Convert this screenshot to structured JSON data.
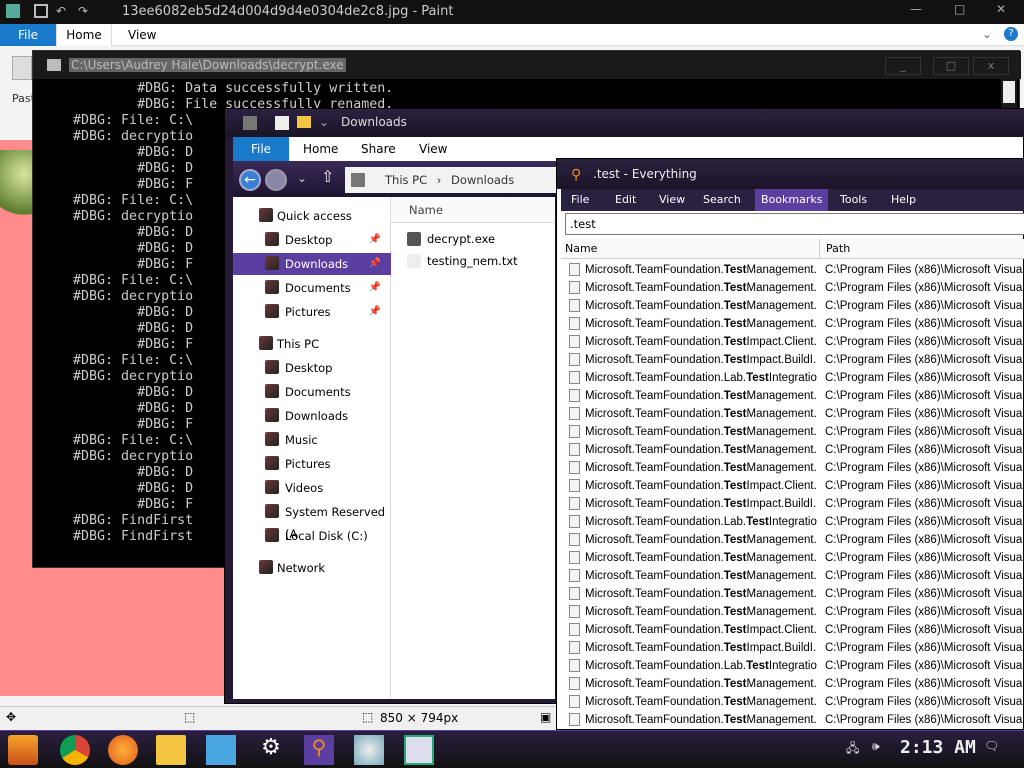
{
  "paint": {
    "title": "13ee6082eb5d24d004d9d4e0304de2c8.jpg - Paint",
    "tabs": [
      "File",
      "Home",
      "View"
    ],
    "paste_label": "Past",
    "canvas_size": "850 × 794px"
  },
  "cmd": {
    "title": "C:\\Users\\Audrey Hale\\Downloads\\decrypt.exe",
    "lines": [
      "            #DBG: Data successfully written.",
      "            #DBG: File successfully renamed.",
      "    #DBG: File: C:\\",
      "    #DBG: decryptio",
      "            #DBG: D",
      "            #DBG: D",
      "            #DBG: F",
      "    #DBG: File: C:\\",
      "    #DBG: decryptio",
      "            #DBG: D",
      "            #DBG: D",
      "            #DBG: F",
      "    #DBG: File: C:\\",
      "    #DBG: decryptio",
      "            #DBG: D",
      "            #DBG: D",
      "            #DBG: F",
      "    #DBG: File: C:\\",
      "    #DBG: decryptio",
      "            #DBG: D",
      "            #DBG: D",
      "            #DBG: F",
      "    #DBG: File: C:\\",
      "    #DBG: decryptio",
      "            #DBG: D",
      "            #DBG: D",
      "            #DBG: F",
      "    #DBG: FindFirst",
      "    #DBG: FindFirst"
    ]
  },
  "explorer": {
    "title": "Downloads",
    "tabs": [
      "File",
      "Home",
      "Share",
      "View"
    ],
    "breadcrumb": [
      "This PC",
      "Downloads"
    ],
    "nav": [
      {
        "label": "Quick access",
        "top": true,
        "pin": false
      },
      {
        "label": "Desktop",
        "pin": true
      },
      {
        "label": "Downloads",
        "pin": true,
        "selected": true
      },
      {
        "label": "Documents",
        "pin": true
      },
      {
        "label": "Pictures",
        "pin": true
      },
      {
        "label": "This PC",
        "top": true
      },
      {
        "label": "Desktop"
      },
      {
        "label": "Documents"
      },
      {
        "label": "Downloads"
      },
      {
        "label": "Music"
      },
      {
        "label": "Pictures"
      },
      {
        "label": "Videos"
      },
      {
        "label": "System Reserved (A"
      },
      {
        "label": "Local Disk (C:)"
      },
      {
        "label": "Network",
        "top": true
      }
    ],
    "column_name": "Name",
    "files": [
      "decrypt.exe",
      "testing_nem.txt"
    ]
  },
  "everything": {
    "title": ".test - Everything",
    "menu": [
      "File",
      "Edit",
      "View",
      "Search",
      "Bookmarks",
      "Tools",
      "Help"
    ],
    "menu_selected": "Bookmarks",
    "search": ".test",
    "col_name": "Name",
    "col_path": "Path",
    "rows": [
      [
        "Microsoft.TeamFoundation.",
        "Test",
        "Management...."
      ],
      [
        "Microsoft.TeamFoundation.",
        "Test",
        "Management...."
      ],
      [
        "Microsoft.TeamFoundation.",
        "Test",
        "Management...."
      ],
      [
        "Microsoft.TeamFoundation.",
        "Test",
        "Management...."
      ],
      [
        "Microsoft.TeamFoundation.",
        "Test",
        "Impact.Client...."
      ],
      [
        "Microsoft.TeamFoundation.",
        "Test",
        "Impact.BuildI..."
      ],
      [
        "Microsoft.TeamFoundation.Lab.",
        "Test",
        "Integratio..."
      ],
      [
        "Microsoft.TeamFoundation.",
        "Test",
        "Management...."
      ],
      [
        "Microsoft.TeamFoundation.",
        "Test",
        "Management...."
      ],
      [
        "Microsoft.TeamFoundation.",
        "Test",
        "Management...."
      ],
      [
        "Microsoft.TeamFoundation.",
        "Test",
        "Management...."
      ],
      [
        "Microsoft.TeamFoundation.",
        "Test",
        "Management...."
      ],
      [
        "Microsoft.TeamFoundation.",
        "Test",
        "Impact.Client...."
      ],
      [
        "Microsoft.TeamFoundation.",
        "Test",
        "Impact.BuildI..."
      ],
      [
        "Microsoft.TeamFoundation.Lab.",
        "Test",
        "Integratio..."
      ],
      [
        "Microsoft.TeamFoundation.",
        "Test",
        "Management...."
      ],
      [
        "Microsoft.TeamFoundation.",
        "Test",
        "Management...."
      ],
      [
        "Microsoft.TeamFoundation.",
        "Test",
        "Management...."
      ],
      [
        "Microsoft.TeamFoundation.",
        "Test",
        "Management...."
      ],
      [
        "Microsoft.TeamFoundation.",
        "Test",
        "Management...."
      ],
      [
        "Microsoft.TeamFoundation.",
        "Test",
        "Impact.Client...."
      ],
      [
        "Microsoft.TeamFoundation.",
        "Test",
        "Impact.BuildI..."
      ],
      [
        "Microsoft.TeamFoundation.Lab.",
        "Test",
        "Integratio..."
      ],
      [
        "Microsoft.TeamFoundation.",
        "Test",
        "Management...."
      ],
      [
        "Microsoft.TeamFoundation.",
        "Test",
        "Management...."
      ],
      [
        "Microsoft.TeamFoundation.",
        "Test",
        "Management...."
      ]
    ],
    "path": "C:\\Program Files (x86)\\Microsoft Visual Stu"
  },
  "taskbar": {
    "clock": "2:13 AM"
  },
  "colors": {
    "accent": "#5b3fa0",
    "file_tab": "#1979ca",
    "canvas": "#ff8b8b"
  }
}
